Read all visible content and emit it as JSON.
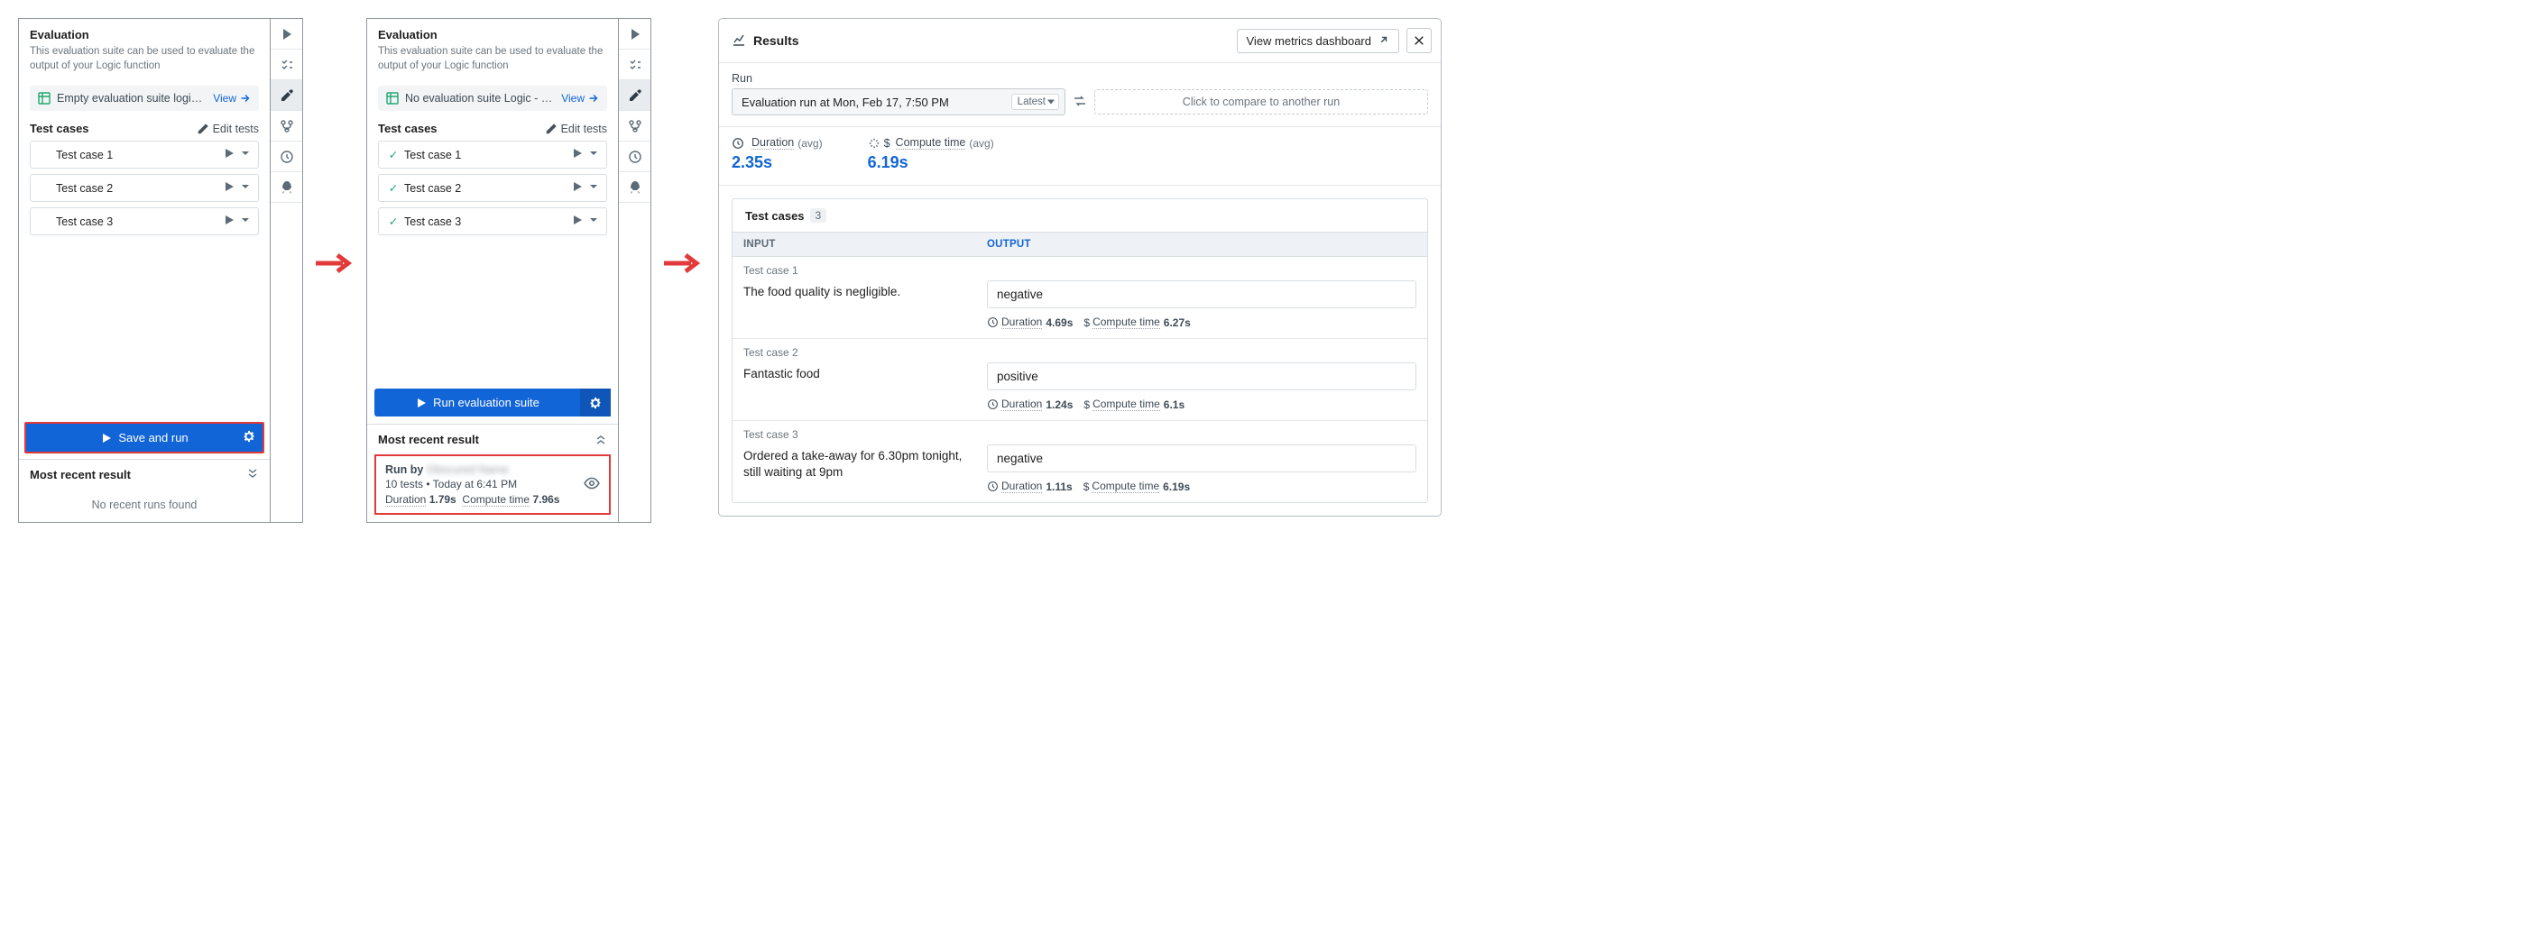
{
  "panel1": {
    "title": "Evaluation",
    "desc": "This evaluation suite can be used to evaluate the output of your Logic function",
    "suite_label": "Empty evaluation suite logic - evalu…",
    "view": "View",
    "tests_header": "Test cases",
    "edit_tests": "Edit tests",
    "tests": [
      {
        "name": "Test case 1",
        "passed": false
      },
      {
        "name": "Test case 2",
        "passed": false
      },
      {
        "name": "Test case 3",
        "passed": false
      }
    ],
    "save_run": "Save and run",
    "recent_header": "Most recent result",
    "no_runs": "No recent runs found"
  },
  "panel2": {
    "title": "Evaluation",
    "desc": "This evaluation suite can be used to evaluate the output of your Logic function",
    "suite_label": "No evaluation suite Logic - evaluati…",
    "view": "View",
    "tests_header": "Test cases",
    "edit_tests": "Edit tests",
    "tests": [
      {
        "name": "Test case 1",
        "passed": true
      },
      {
        "name": "Test case 2",
        "passed": true
      },
      {
        "name": "Test case 3",
        "passed": true
      }
    ],
    "run_suite": "Run evaluation suite",
    "recent_header": "Most recent result",
    "run_by_prefix": "Run by",
    "run_by_name": "Obscured Name",
    "run_meta": "10 tests • Today at 6:41 PM",
    "duration_label": "Duration",
    "duration_val": "1.79s",
    "compute_label": "Compute time",
    "compute_val": "7.96s"
  },
  "results": {
    "title": "Results",
    "metrics_btn": "View metrics dashboard",
    "run_label": "Run",
    "run_name": "Evaluation run at Mon, Feb 17, 7:50 PM",
    "latest": "Latest",
    "compare": "Click to compare to another run",
    "duration_label": "Duration",
    "compute_label": "Compute time",
    "avg": "(avg)",
    "duration_val": "2.35s",
    "compute_val": "6.19s",
    "tests_label": "Test cases",
    "tests_count": "3",
    "col_input": "INPUT",
    "col_output": "OUTPUT",
    "rows": [
      {
        "label": "Test case 1",
        "input": "The food quality is negligible.",
        "output": "negative",
        "dur": "4.69s",
        "comp": "6.27s"
      },
      {
        "label": "Test case 2",
        "input": "Fantastic food",
        "output": "positive",
        "dur": "1.24s",
        "comp": "6.1s"
      },
      {
        "label": "Test case 3",
        "input": "Ordered a take-away for 6.30pm tonight, still waiting at 9pm",
        "output": "negative",
        "dur": "1.11s",
        "comp": "6.19s"
      }
    ]
  }
}
